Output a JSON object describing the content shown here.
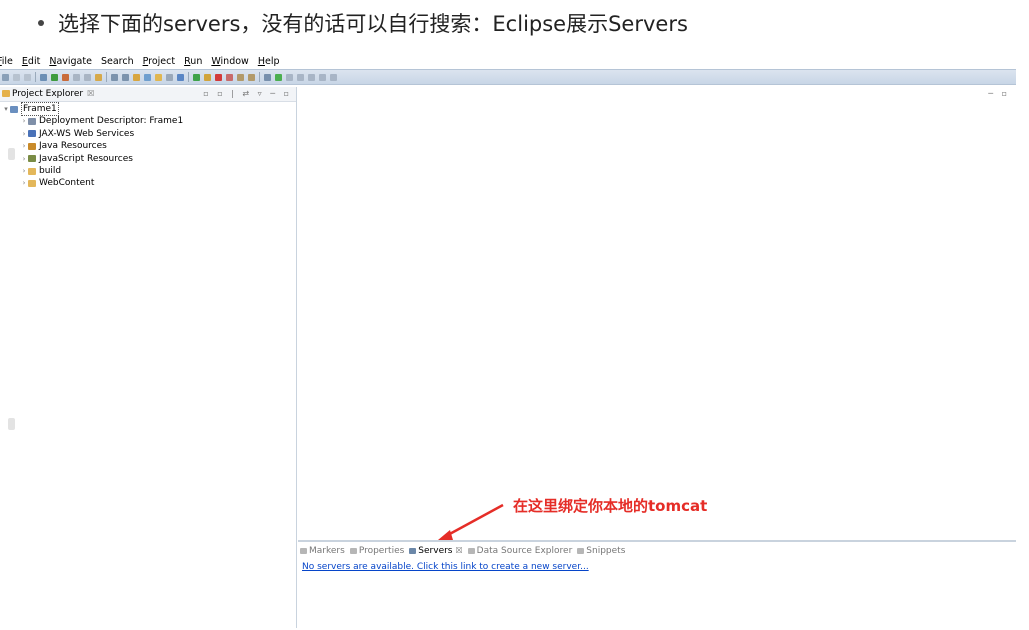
{
  "slide": {
    "heading": "选择下面的servers，没有的话可以自行搜索：Eclipse展示Servers"
  },
  "menubar": {
    "items": [
      {
        "mnemonic": "F",
        "rest": "ile"
      },
      {
        "mnemonic": "E",
        "rest": "dit"
      },
      {
        "mnemonic": "N",
        "rest": "avigate"
      },
      {
        "mnemonic": "",
        "rest": "Search"
      },
      {
        "mnemonic": "P",
        "rest": "roject"
      },
      {
        "mnemonic": "R",
        "rest": "un"
      },
      {
        "mnemonic": "W",
        "rest": "indow"
      },
      {
        "mnemonic": "H",
        "rest": "elp"
      }
    ]
  },
  "explorer": {
    "title": "Project Explorer",
    "close": "☒",
    "tools": "▫ ▫ | ⇄ ▿ ─ ▫",
    "project": "Frame1",
    "children": [
      {
        "label": "Deployment Descriptor: Frame1",
        "icon": "descriptor-icon",
        "color": "#7f8fa8"
      },
      {
        "label": "JAX-WS Web Services",
        "icon": "webservice-icon",
        "color": "#4a72b8"
      },
      {
        "label": "Java Resources",
        "icon": "java-resources-icon",
        "color": "#c98b2a"
      },
      {
        "label": "JavaScript Resources",
        "icon": "javascript-resources-icon",
        "color": "#7a8c45"
      },
      {
        "label": "build",
        "icon": "folder-icon",
        "color": "#e3b75a"
      },
      {
        "label": "WebContent",
        "icon": "folder-icon",
        "color": "#e3b75a"
      }
    ]
  },
  "editor": {
    "tools": "─ ▫"
  },
  "bottom": {
    "tabs": [
      {
        "label": "Markers",
        "active": false
      },
      {
        "label": "Properties",
        "active": false
      },
      {
        "label": "Servers",
        "active": true
      },
      {
        "label": "Data Source Explorer",
        "active": false
      },
      {
        "label": "Snippets",
        "active": false
      }
    ],
    "servers_close": "☒",
    "servers_link": "No servers are available. Click this link to create a new server..."
  },
  "annotation": {
    "text": "在这里绑定你本地的tomcat",
    "color": "#e52d27"
  }
}
